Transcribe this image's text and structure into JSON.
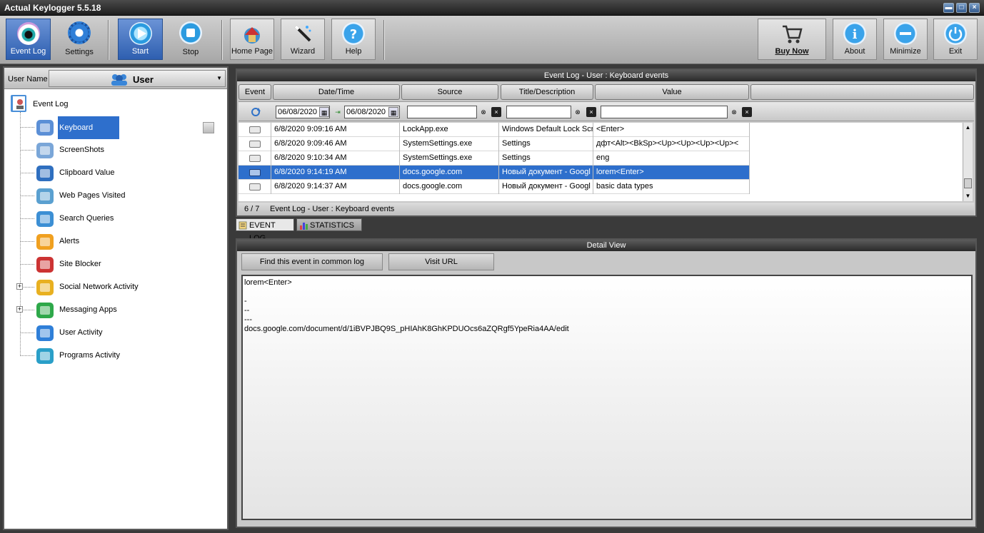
{
  "window": {
    "title": "Actual Keylogger 5.5.18",
    "minimize_glyph": "▬",
    "restore_glyph": "□",
    "close_glyph": "×"
  },
  "toolbar": {
    "event_log": "Event Log",
    "settings": "Settings",
    "start": "Start",
    "stop": "Stop",
    "home_page": "Home Page",
    "wizard": "Wizard",
    "help": "Help",
    "buy_now": "Buy Now",
    "about": "About",
    "minimize": "Minimize",
    "exit": "Exit"
  },
  "user_bar": {
    "label": "User Name",
    "selected": "User"
  },
  "tree": {
    "root": "Event Log",
    "items": [
      {
        "label": "Keyboard events",
        "icon": "keyboard-icon",
        "expandable": false
      },
      {
        "label": "ScreenShots",
        "icon": "screenshot-icon",
        "expandable": false
      },
      {
        "label": "Clipboard Value",
        "icon": "clipboard-icon",
        "expandable": false
      },
      {
        "label": "Web Pages Visited",
        "icon": "globe-icon",
        "expandable": false
      },
      {
        "label": "Search Queries",
        "icon": "magnifier-icon",
        "expandable": false
      },
      {
        "label": "Alerts",
        "icon": "alert-icon",
        "expandable": false
      },
      {
        "label": "Site Blocker",
        "icon": "site-blocker-icon",
        "expandable": false
      },
      {
        "label": "Social Network Activity",
        "icon": "social-network-icon",
        "expandable": true
      },
      {
        "label": "Messaging Apps",
        "icon": "chat-bubbles-icon",
        "expandable": true
      },
      {
        "label": "User Activity",
        "icon": "user-clock-icon",
        "expandable": false
      },
      {
        "label": "Programs Activity",
        "icon": "programs-icon",
        "expandable": false
      }
    ]
  },
  "log_panel": {
    "title": "Event Log - User : Keyboard events",
    "columns": {
      "event": "Event",
      "datetime": "Date/Time",
      "source": "Source",
      "title": "Title/Description",
      "value": "Value"
    },
    "filters": {
      "date_from": "06/08/2020",
      "date_to": "06/08/2020",
      "source": "",
      "title": "",
      "value": ""
    },
    "rows": [
      {
        "datetime": "6/8/2020 9:09:16 AM",
        "source": "LockApp.exe",
        "title": "Windows Default Lock Scr",
        "value": "<Enter>",
        "selected": false
      },
      {
        "datetime": "6/8/2020 9:09:46 AM",
        "source": "SystemSettings.exe",
        "title": "Settings",
        "value": "дфт<Alt><BkSp><Up><Up><Up><Up><",
        "selected": false
      },
      {
        "datetime": "6/8/2020 9:10:34 AM",
        "source": "SystemSettings.exe",
        "title": "Settings",
        "value": "eng",
        "selected": false
      },
      {
        "datetime": "6/8/2020 9:14:19 AM",
        "source": "docs.google.com",
        "title": "Новый документ - Googl",
        "value": "lorem<Enter>",
        "selected": true
      },
      {
        "datetime": "6/8/2020 9:14:37 AM",
        "source": "docs.google.com",
        "title": "Новый документ - Googl",
        "value": "basic data types",
        "selected": false
      }
    ],
    "status_count": "6 / 7",
    "status_text": "Event Log - User : Keyboard events"
  },
  "tabs": {
    "event_log": "EVENT LOG",
    "statistics": "STATISTICS"
  },
  "detail": {
    "title": "Detail View",
    "find_button": "Find this event in common log",
    "visit_button": "Visit URL",
    "text": "lorem<Enter>\n\n-\n--\n---\ndocs.google.com/document/d/1iBVPJBQ9S_pHIAhK8GhKPDUOcs6aZQRgf5YpeRia4AA/edit"
  },
  "colors": {
    "selection": "#2e6fcc",
    "title_bar": "#2a2a2a",
    "panel_bg": "#c8c8c8"
  }
}
